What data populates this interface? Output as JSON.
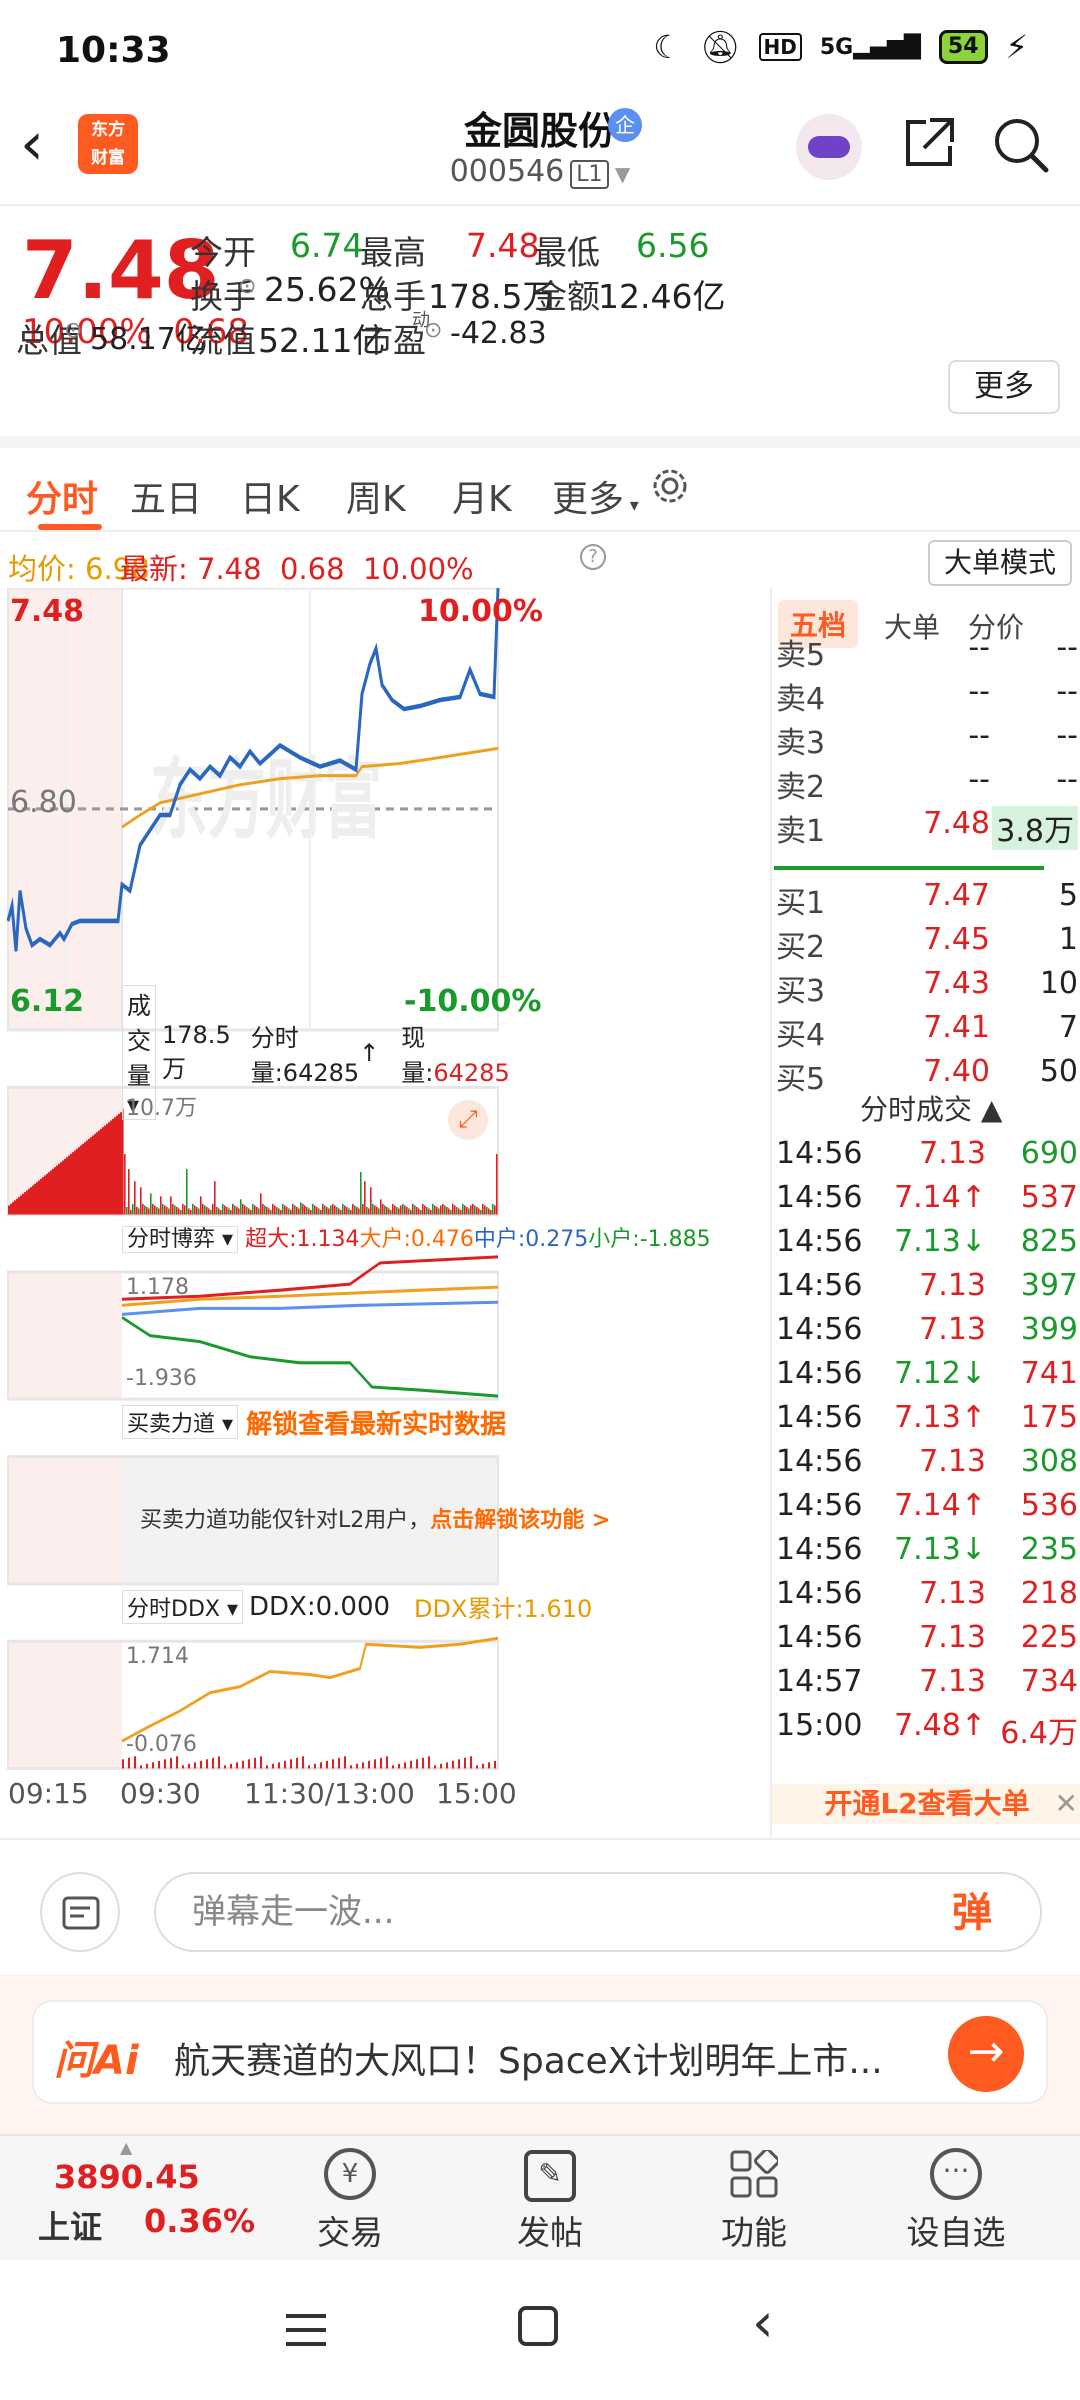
{
  "status": {
    "time": "10:33",
    "network": "5G",
    "battery": "54"
  },
  "header": {
    "logo_line1": "东方",
    "logo_line2": "财富",
    "stock_name": "金圆股份",
    "qi_badge": "企",
    "stock_code": "000546",
    "level_badge": "L1"
  },
  "quote": {
    "price": "7.48",
    "change_pct": "10.00%",
    "change_amt": "0.68",
    "open_label": "今开",
    "open": "6.74",
    "high_label": "最高",
    "high": "7.48",
    "low_label": "最低",
    "low": "6.56",
    "turnover_label": "换手",
    "turnover": "25.62%",
    "volume_label": "总手",
    "volume": "178.5万",
    "amount_label": "金额",
    "amount": "12.46亿",
    "mktcap_label": "总值",
    "mktcap": "58.17亿",
    "float_label": "流值",
    "float": "52.11亿",
    "pe_label": "市盈",
    "pe_sup": "动",
    "pe": "-42.83",
    "more_button": "更多"
  },
  "tabs": {
    "t1": "分时",
    "t2": "五日",
    "t3": "日K",
    "t4": "周K",
    "t5": "月K",
    "t6": "更多"
  },
  "subinfo": {
    "avg_label": "均价:",
    "avg": "6.98",
    "latest_label": "最新:",
    "latest": "7.48",
    "change": "0.68",
    "pct": "10.00%",
    "mode_button": "大单模式"
  },
  "chart": {
    "price_top": "7.48",
    "price_mid": "6.80",
    "price_bottom": "6.12",
    "pct_top": "10.00%",
    "pct_bottom": "-10.00%",
    "vol_label": "成交量",
    "vol_total": "178.5万",
    "vol_tick_label": "分时量:64285",
    "vol_now_label": "现量:",
    "vol_now": "64285",
    "vol_max": "10.7万",
    "game_label": "分时博弈",
    "game_super": "超大:1.134",
    "game_big": "大户:0.476",
    "game_mid": "中户:0.275",
    "game_small": "小户:-1.885",
    "game_max": "1.178",
    "game_min": "-1.936",
    "force_label": "买卖力道",
    "force_unlock": "解锁查看最新实时数据",
    "force_notice": "买卖力道功能仅针对L2用户，",
    "force_link": "点击解锁该功能 >",
    "ddx_label": "分时DDX",
    "ddx_value": "DDX:0.000",
    "ddx_total": "DDX累计:1.610",
    "ddx_max": "1.714",
    "ddx_min": "-0.076",
    "time_labels": [
      "09:15",
      "09:30",
      "11:30/13:00",
      "15:00"
    ],
    "watermark": "东方财富"
  },
  "orderbook": {
    "tabs": [
      "五档",
      "大单",
      "分价"
    ],
    "asks": [
      {
        "label": "卖5",
        "price": "--",
        "vol": "--"
      },
      {
        "label": "卖4",
        "price": "--",
        "vol": "--"
      },
      {
        "label": "卖3",
        "price": "--",
        "vol": "--"
      },
      {
        "label": "卖2",
        "price": "--",
        "vol": "--"
      },
      {
        "label": "卖1",
        "price": "7.48",
        "vol": "3.8万"
      }
    ],
    "bids": [
      {
        "label": "买1",
        "price": "7.47",
        "vol": "5"
      },
      {
        "label": "买2",
        "price": "7.45",
        "vol": "1"
      },
      {
        "label": "买3",
        "price": "7.43",
        "vol": "10"
      },
      {
        "label": "买4",
        "price": "7.41",
        "vol": "7"
      },
      {
        "label": "买5",
        "price": "7.40",
        "vol": "50"
      }
    ],
    "ticks_title": "分时成交",
    "ticks": [
      {
        "t": "14:56",
        "p": "7.13",
        "arrow": "",
        "v": "690",
        "vc": "green"
      },
      {
        "t": "14:56",
        "p": "7.14",
        "arrow": "↑",
        "v": "537",
        "vc": "red"
      },
      {
        "t": "14:56",
        "p": "7.13",
        "arrow": "↓",
        "v": "825",
        "vc": "green"
      },
      {
        "t": "14:56",
        "p": "7.13",
        "arrow": "",
        "v": "397",
        "vc": "green"
      },
      {
        "t": "14:56",
        "p": "7.13",
        "arrow": "",
        "v": "399",
        "vc": "green"
      },
      {
        "t": "14:56",
        "p": "7.12",
        "arrow": "↓",
        "v": "741",
        "vc": "red"
      },
      {
        "t": "14:56",
        "p": "7.13",
        "arrow": "↑",
        "v": "175",
        "vc": "red"
      },
      {
        "t": "14:56",
        "p": "7.13",
        "arrow": "",
        "v": "308",
        "vc": "green"
      },
      {
        "t": "14:56",
        "p": "7.14",
        "arrow": "↑",
        "v": "536",
        "vc": "red"
      },
      {
        "t": "14:56",
        "p": "7.13",
        "arrow": "↓",
        "v": "235",
        "vc": "green"
      },
      {
        "t": "14:56",
        "p": "7.13",
        "arrow": "",
        "v": "218",
        "vc": "red"
      },
      {
        "t": "14:56",
        "p": "7.13",
        "arrow": "",
        "v": "225",
        "vc": "red"
      },
      {
        "t": "14:57",
        "p": "7.13",
        "arrow": "",
        "v": "734",
        "vc": "red"
      },
      {
        "t": "15:00",
        "p": "7.48",
        "arrow": "↑",
        "v": "6.4万",
        "vc": "red"
      }
    ],
    "l2_banner": "开通L2查看大单"
  },
  "chat": {
    "placeholder": "弹幕走一波...",
    "danmu": "弹"
  },
  "ai": {
    "logo": "问Ai",
    "text": "航天赛道的大风口！SpaceX计划明年上市..."
  },
  "bottomnav": {
    "index_value": "3890.45",
    "index_name": "上证",
    "index_pct": "0.36%",
    "trade": "交易",
    "post": "发帖",
    "func": "功能",
    "watch": "设自选"
  }
}
